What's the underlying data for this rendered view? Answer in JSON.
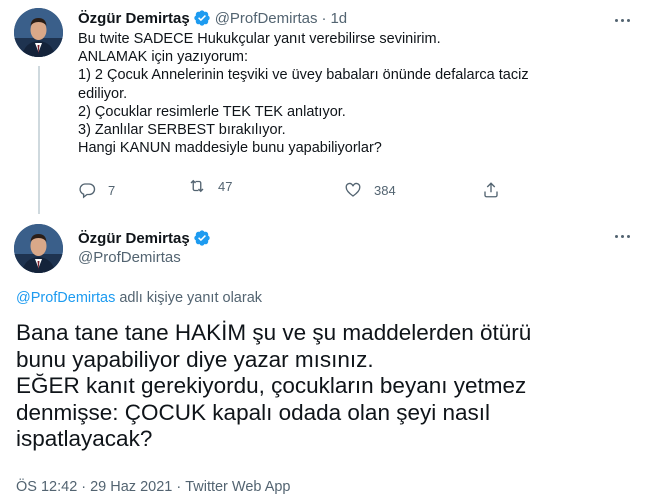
{
  "colors": {
    "accent": "#1d9bf0",
    "text": "#0f1419",
    "muted": "#536471"
  },
  "tweet1": {
    "author_name": "Özgür Demirtaş",
    "author_handle": "@ProfDemirtas",
    "separator": "·",
    "time_ago": "1d",
    "lines": [
      "Bu twite SADECE Hukukçular yanıt verebilirse sevinirim.",
      "ANLAMAK için yazıyorum:",
      "1) 2 Çocuk Annelerinin teşviki ve üvey babaları önünde defalarca taciz",
      "ediliyor.",
      "2) Çocuklar resimlerle TEK TEK anlatıyor.",
      "3) Zanlılar SERBEST bırakılıyor.",
      "Hangi KANUN maddesiyle bunu yapabiliyorlar?"
    ],
    "reply_count": "7",
    "retweet_count": "47",
    "like_count": "384",
    "icons": [
      "reply-icon",
      "retweet-icon",
      "like-icon",
      "share-icon",
      "more-icon",
      "verified-icon"
    ]
  },
  "tweet2": {
    "author_name": "Özgür Demirtaş",
    "author_handle": "@ProfDemirtas",
    "reply_to_link": "@ProfDemirtas",
    "reply_to_suffix": " adlı kişiye yanıt olarak",
    "lines": [
      "Bana tane tane HAKİM şu ve şu maddelerden ötürü",
      "bunu yapabiliyor diye yazar mısınız.",
      "EĞER kanıt gerekiyordu, çocukların beyanı yetmez",
      "denmişse: ÇOCUK kapalı odada olan şeyi nasıl",
      "ispatlayacak?"
    ],
    "time": "ÖS 12:42",
    "separator": "·",
    "date": "29 Haz 2021",
    "source": "Twitter Web App"
  }
}
